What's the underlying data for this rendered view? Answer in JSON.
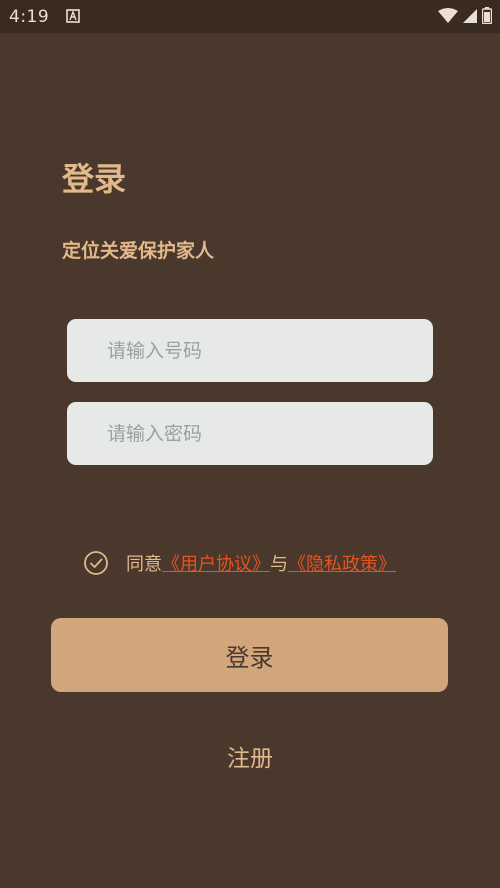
{
  "status_bar": {
    "time": "4:19"
  },
  "login": {
    "title": "登录",
    "subtitle": "定位关爱保护家人",
    "phone_placeholder": "请输入号码",
    "password_placeholder": "请输入密码",
    "agree_prefix": "同意",
    "user_agreement": "《用户协议》",
    "agree_and": "与",
    "privacy_policy": "《隐私政策》",
    "login_button": "登录",
    "register_link": "注册"
  },
  "colors": {
    "background": "#4a382c",
    "accent_text": "#e2b98b",
    "button": "#d1a67d",
    "link": "#e8531d",
    "input_bg": "#e6e9e8"
  }
}
